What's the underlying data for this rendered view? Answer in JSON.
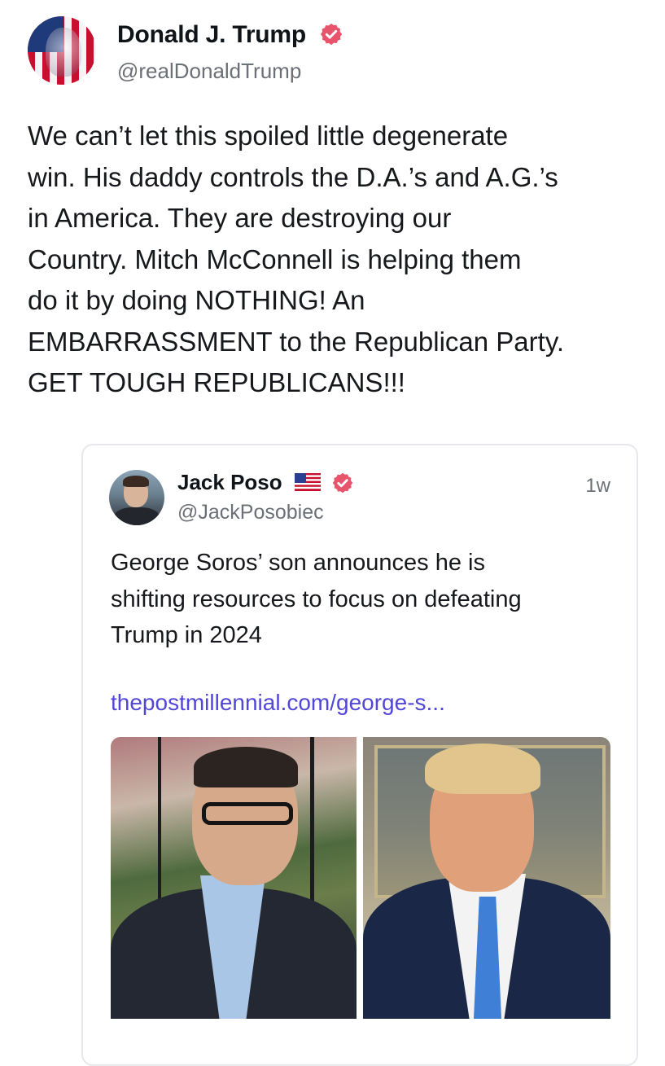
{
  "post": {
    "author_name": "Donald J. Trump",
    "author_handle": "@realDonaldTrump",
    "text_lines": [
      "We can’t let this spoiled little degenerate",
      "win. His daddy controls the D.A.’s and A.G.’s",
      "in America. They are destroying our",
      "Country. Mitch McConnell is helping them",
      "do it by doing NOTHING! An",
      "EMBARRASSMENT to the Republican Party.",
      "GET TOUGH REPUBLICANS!!!"
    ]
  },
  "quoted_post": {
    "author_name": "Jack Poso",
    "author_handle": "@JackPosobiec",
    "time_ago": "1w",
    "text_lines": [
      "George Soros’ son announces he is",
      "shifting resources to focus on defeating",
      "Trump in 2024"
    ],
    "link_text": "thepostmillennial.com/george-s..."
  },
  "icons": {
    "verified": "verified-badge-icon",
    "flag": "us-flag-icon"
  },
  "colors": {
    "verified_badge": "#e8546c",
    "link": "#5146d6",
    "handle_gray": "#6b6f76"
  }
}
